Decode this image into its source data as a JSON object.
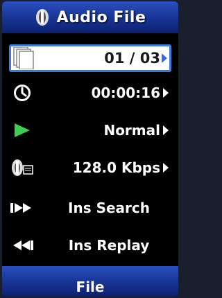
{
  "header": {
    "title": "Audio File",
    "icon": "audio-file-icon"
  },
  "file": {
    "counter": "01 / 03",
    "icon": "documents-icon"
  },
  "time": {
    "value": "00:00:16",
    "icon": "clock-icon"
  },
  "mode": {
    "value": "Normal",
    "icon": "play-icon",
    "icon_color": "#3ecf4f"
  },
  "bitrate": {
    "value": "128.0 Kbps",
    "icon": "audio-bitrate-icon"
  },
  "ins_search": {
    "label": "Ins Search",
    "icon": "fast-forward-icon"
  },
  "ins_replay": {
    "label": "Ins Replay",
    "icon": "rewind-icon"
  },
  "footer": {
    "label": "File"
  },
  "colors": {
    "accent": "#2f6ce0",
    "bar": "#16318f"
  }
}
